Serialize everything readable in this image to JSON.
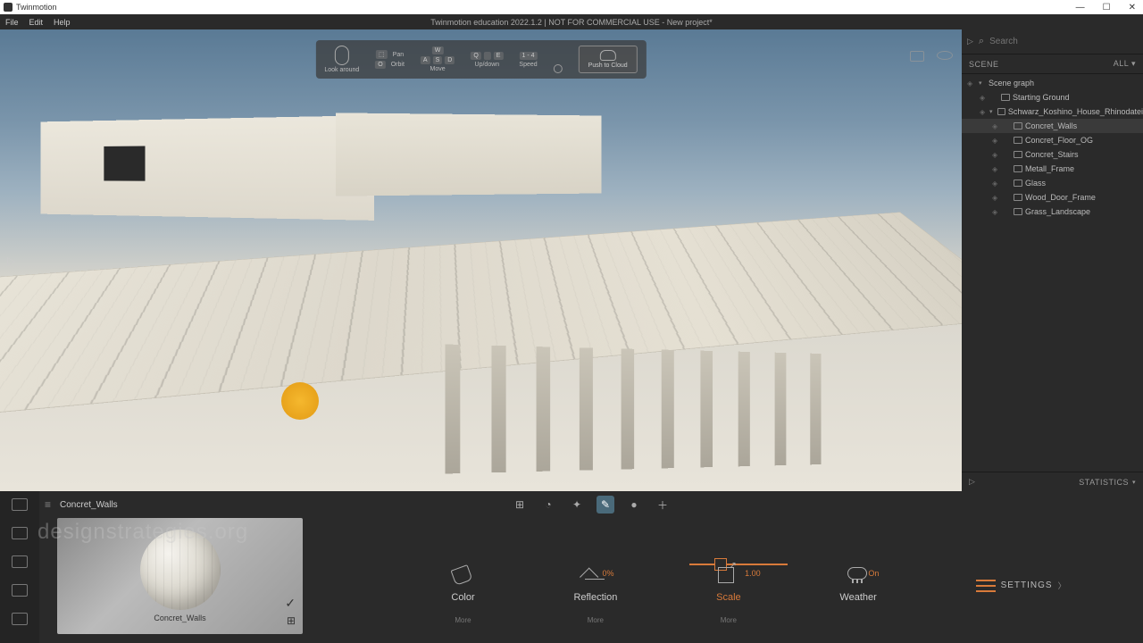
{
  "app_name": "Twinmotion",
  "window_title": "Twinmotion education 2022.1.2 | NOT FOR COMMERCIAL USE - New project*",
  "menu": {
    "file": "File",
    "edit": "Edit",
    "help": "Help"
  },
  "nav_hints": {
    "look_around": "Look around",
    "pan": "Pan",
    "orbit": "Orbit",
    "move": "Move",
    "updown": "Up/down",
    "speed": "Speed",
    "speed_val": "1 - 4",
    "push_cloud": "Push to Cloud",
    "keys_move": [
      "A",
      "S",
      "D"
    ],
    "keys_move_top": "W",
    "keys_ud": [
      "Q",
      "",
      "E"
    ],
    "keys_orbit": "O"
  },
  "search": {
    "placeholder": "Search"
  },
  "scene": {
    "header": "SCENE",
    "all": "ALL",
    "stats": "STATISTICS",
    "graph": "Scene graph",
    "items": [
      {
        "label": "Starting Ground",
        "indent": 1
      },
      {
        "label": "Schwarz_Koshino_House_Rhinodatei",
        "indent": 1,
        "exp": true
      },
      {
        "label": "Concret_Walls",
        "indent": 2,
        "sel": true
      },
      {
        "label": "Concret_Floor_OG",
        "indent": 2
      },
      {
        "label": "Concret_Stairs",
        "indent": 2
      },
      {
        "label": "Metall_Frame",
        "indent": 2
      },
      {
        "label": "Glass",
        "indent": 2
      },
      {
        "label": "Wood_Door_Frame",
        "indent": 2
      },
      {
        "label": "Grass_Landscape",
        "indent": 2
      }
    ]
  },
  "dock": {
    "title": "Concret_Walls",
    "material_name": "Concret_Walls",
    "props": {
      "color": "Color",
      "reflection": "Reflection",
      "reflection_val": "0%",
      "scale": "Scale",
      "scale_val": "1.00",
      "weather": "Weather",
      "weather_val": "On",
      "settings": "SETTINGS",
      "more": "More"
    }
  },
  "watermark": "designstrategies.org"
}
